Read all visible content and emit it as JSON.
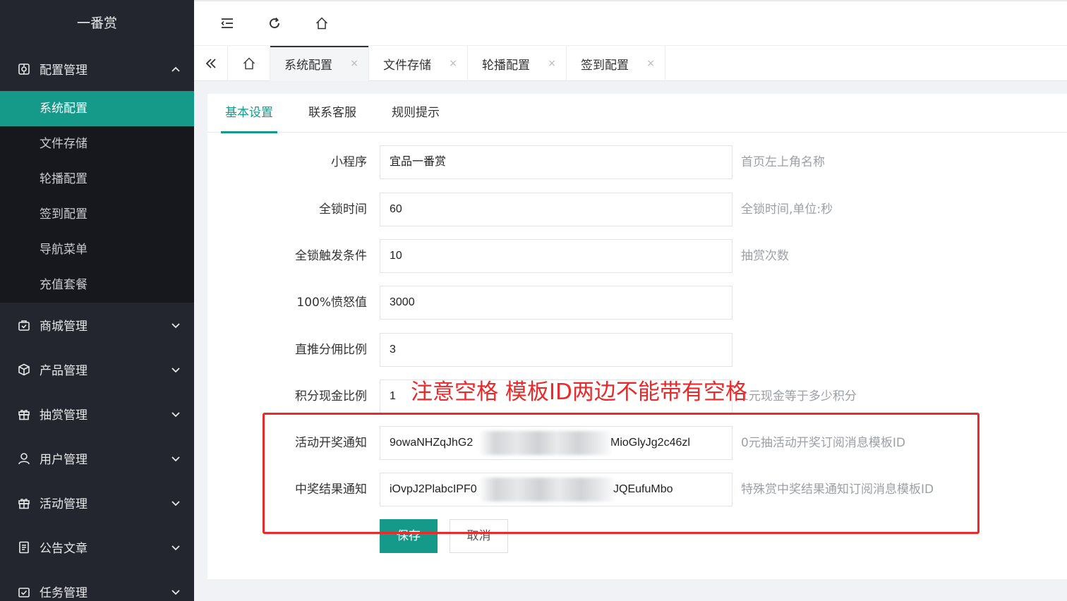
{
  "brand": "一番赏",
  "sidebar": {
    "config_group": {
      "label": "配置管理",
      "icon": "settings-icon",
      "expanded": true
    },
    "config_items": [
      {
        "label": "系统配置",
        "active": true
      },
      {
        "label": "文件存储",
        "active": false
      },
      {
        "label": "轮播配置",
        "active": false
      },
      {
        "label": "签到配置",
        "active": false
      },
      {
        "label": "导航菜单",
        "active": false
      },
      {
        "label": "充值套餐",
        "active": false
      }
    ],
    "groups": [
      {
        "label": "商城管理",
        "icon": "shop-icon"
      },
      {
        "label": "产品管理",
        "icon": "cube-icon"
      },
      {
        "label": "抽赏管理",
        "icon": "gift-icon"
      },
      {
        "label": "用户管理",
        "icon": "user-icon"
      },
      {
        "label": "活动管理",
        "icon": "gift-icon"
      },
      {
        "label": "公告文章",
        "icon": "document-icon"
      },
      {
        "label": "任务管理",
        "icon": "task-icon"
      }
    ]
  },
  "topbar": {
    "icons": [
      "menu-toggle-icon",
      "refresh-icon",
      "home-icon"
    ]
  },
  "tabs": {
    "items": [
      {
        "label": "系统配置",
        "active": true
      },
      {
        "label": "文件存储",
        "active": false
      },
      {
        "label": "轮播配置",
        "active": false
      },
      {
        "label": "签到配置",
        "active": false
      }
    ],
    "close_glyph": "×"
  },
  "subtabs": [
    {
      "label": "基本设置",
      "active": true
    },
    {
      "label": "联系客服",
      "active": false
    },
    {
      "label": "规则提示",
      "active": false
    }
  ],
  "form": {
    "rows": [
      {
        "label": "小程序",
        "value": "宜品一番赏",
        "hint": "首页左上角名称"
      },
      {
        "label": "全锁时间",
        "value": "60",
        "hint": "全锁时间,单位:秒"
      },
      {
        "label": "全锁触发条件",
        "value": "10",
        "hint": "抽赏次数"
      },
      {
        "label": "100%愤怒值",
        "value": "3000",
        "hint": ""
      },
      {
        "label": "直推分佣比例",
        "value": "3",
        "hint": ""
      },
      {
        "label": "积分现金比例",
        "value": "1",
        "hint": "1元现金等于多少积分"
      },
      {
        "label": "活动开奖通知",
        "value_left": "9owaNHZqJhG2",
        "value_right": "MioGlyJg2c46zl",
        "hint": "0元抽活动开奖订阅消息模板ID"
      },
      {
        "label": "中奖结果通知",
        "value_left": "iOvpJ2PlabcIPF0",
        "value_right": "JQEufuMbo",
        "hint": "特殊赏中奖结果通知订阅消息模板ID"
      }
    ],
    "save_label": "保存",
    "cancel_label": "取消"
  },
  "annotation": {
    "text": "注意空格 模板ID两边不能带有空格",
    "color": "#ea2a2a"
  },
  "colors": {
    "accent": "#159a89",
    "sidebar_bg": "#23262e",
    "sidebar_sub_bg": "#16181d"
  }
}
